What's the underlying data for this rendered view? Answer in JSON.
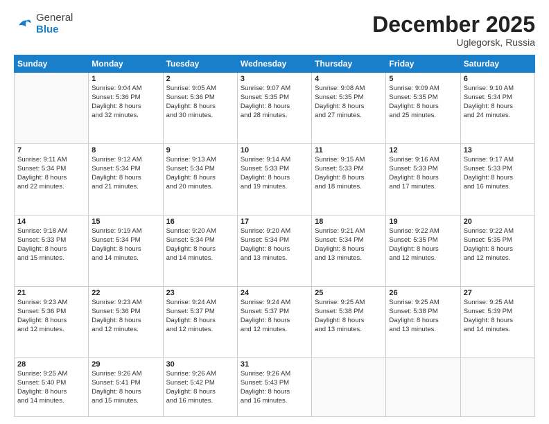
{
  "header": {
    "logo_general": "General",
    "logo_blue": "Blue",
    "month": "December 2025",
    "location": "Uglegorsk, Russia"
  },
  "days_header": [
    "Sunday",
    "Monday",
    "Tuesday",
    "Wednesday",
    "Thursday",
    "Friday",
    "Saturday"
  ],
  "weeks": [
    [
      {
        "num": "",
        "info": ""
      },
      {
        "num": "1",
        "info": "Sunrise: 9:04 AM\nSunset: 5:36 PM\nDaylight: 8 hours\nand 32 minutes."
      },
      {
        "num": "2",
        "info": "Sunrise: 9:05 AM\nSunset: 5:36 PM\nDaylight: 8 hours\nand 30 minutes."
      },
      {
        "num": "3",
        "info": "Sunrise: 9:07 AM\nSunset: 5:35 PM\nDaylight: 8 hours\nand 28 minutes."
      },
      {
        "num": "4",
        "info": "Sunrise: 9:08 AM\nSunset: 5:35 PM\nDaylight: 8 hours\nand 27 minutes."
      },
      {
        "num": "5",
        "info": "Sunrise: 9:09 AM\nSunset: 5:35 PM\nDaylight: 8 hours\nand 25 minutes."
      },
      {
        "num": "6",
        "info": "Sunrise: 9:10 AM\nSunset: 5:34 PM\nDaylight: 8 hours\nand 24 minutes."
      }
    ],
    [
      {
        "num": "7",
        "info": "Sunrise: 9:11 AM\nSunset: 5:34 PM\nDaylight: 8 hours\nand 22 minutes."
      },
      {
        "num": "8",
        "info": "Sunrise: 9:12 AM\nSunset: 5:34 PM\nDaylight: 8 hours\nand 21 minutes."
      },
      {
        "num": "9",
        "info": "Sunrise: 9:13 AM\nSunset: 5:34 PM\nDaylight: 8 hours\nand 20 minutes."
      },
      {
        "num": "10",
        "info": "Sunrise: 9:14 AM\nSunset: 5:33 PM\nDaylight: 8 hours\nand 19 minutes."
      },
      {
        "num": "11",
        "info": "Sunrise: 9:15 AM\nSunset: 5:33 PM\nDaylight: 8 hours\nand 18 minutes."
      },
      {
        "num": "12",
        "info": "Sunrise: 9:16 AM\nSunset: 5:33 PM\nDaylight: 8 hours\nand 17 minutes."
      },
      {
        "num": "13",
        "info": "Sunrise: 9:17 AM\nSunset: 5:33 PM\nDaylight: 8 hours\nand 16 minutes."
      }
    ],
    [
      {
        "num": "14",
        "info": "Sunrise: 9:18 AM\nSunset: 5:33 PM\nDaylight: 8 hours\nand 15 minutes."
      },
      {
        "num": "15",
        "info": "Sunrise: 9:19 AM\nSunset: 5:34 PM\nDaylight: 8 hours\nand 14 minutes."
      },
      {
        "num": "16",
        "info": "Sunrise: 9:20 AM\nSunset: 5:34 PM\nDaylight: 8 hours\nand 14 minutes."
      },
      {
        "num": "17",
        "info": "Sunrise: 9:20 AM\nSunset: 5:34 PM\nDaylight: 8 hours\nand 13 minutes."
      },
      {
        "num": "18",
        "info": "Sunrise: 9:21 AM\nSunset: 5:34 PM\nDaylight: 8 hours\nand 13 minutes."
      },
      {
        "num": "19",
        "info": "Sunrise: 9:22 AM\nSunset: 5:35 PM\nDaylight: 8 hours\nand 12 minutes."
      },
      {
        "num": "20",
        "info": "Sunrise: 9:22 AM\nSunset: 5:35 PM\nDaylight: 8 hours\nand 12 minutes."
      }
    ],
    [
      {
        "num": "21",
        "info": "Sunrise: 9:23 AM\nSunset: 5:36 PM\nDaylight: 8 hours\nand 12 minutes."
      },
      {
        "num": "22",
        "info": "Sunrise: 9:23 AM\nSunset: 5:36 PM\nDaylight: 8 hours\nand 12 minutes."
      },
      {
        "num": "23",
        "info": "Sunrise: 9:24 AM\nSunset: 5:37 PM\nDaylight: 8 hours\nand 12 minutes."
      },
      {
        "num": "24",
        "info": "Sunrise: 9:24 AM\nSunset: 5:37 PM\nDaylight: 8 hours\nand 12 minutes."
      },
      {
        "num": "25",
        "info": "Sunrise: 9:25 AM\nSunset: 5:38 PM\nDaylight: 8 hours\nand 13 minutes."
      },
      {
        "num": "26",
        "info": "Sunrise: 9:25 AM\nSunset: 5:38 PM\nDaylight: 8 hours\nand 13 minutes."
      },
      {
        "num": "27",
        "info": "Sunrise: 9:25 AM\nSunset: 5:39 PM\nDaylight: 8 hours\nand 14 minutes."
      }
    ],
    [
      {
        "num": "28",
        "info": "Sunrise: 9:25 AM\nSunset: 5:40 PM\nDaylight: 8 hours\nand 14 minutes."
      },
      {
        "num": "29",
        "info": "Sunrise: 9:26 AM\nSunset: 5:41 PM\nDaylight: 8 hours\nand 15 minutes."
      },
      {
        "num": "30",
        "info": "Sunrise: 9:26 AM\nSunset: 5:42 PM\nDaylight: 8 hours\nand 16 minutes."
      },
      {
        "num": "31",
        "info": "Sunrise: 9:26 AM\nSunset: 5:43 PM\nDaylight: 8 hours\nand 16 minutes."
      },
      {
        "num": "",
        "info": ""
      },
      {
        "num": "",
        "info": ""
      },
      {
        "num": "",
        "info": ""
      }
    ]
  ]
}
